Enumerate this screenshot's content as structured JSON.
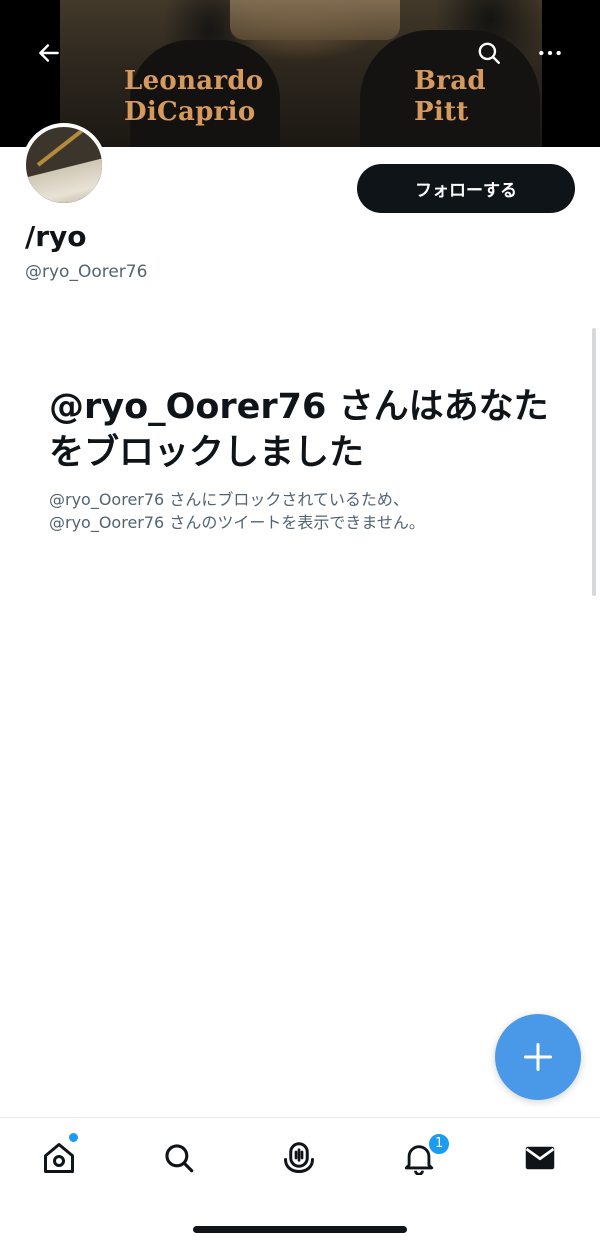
{
  "header": {
    "banner_text_left": [
      "Leonardo",
      "DiCaprio"
    ],
    "banner_text_right": [
      "Brad",
      "Pitt"
    ],
    "back_icon": "arrow-left-icon",
    "search_icon": "search-icon",
    "more_icon": "more-horizontal-icon"
  },
  "profile": {
    "display_name": "/ryo",
    "handle": "@ryo_Oorer76",
    "follow_label": "フォローする"
  },
  "blocked": {
    "title": "@ryo_Oorer76 さんはあなたをブロックしました",
    "description_line1": "@ryo_Oorer76 さんにブロックされているため、",
    "description_line2": "@ryo_Oorer76 さんのツイートを表示できません。"
  },
  "fab": {
    "icon": "plus-icon"
  },
  "tabbar": {
    "items": [
      {
        "name": "home",
        "icon": "home-icon",
        "has_dot": true
      },
      {
        "name": "search",
        "icon": "search-icon"
      },
      {
        "name": "spaces",
        "icon": "spaces-icon"
      },
      {
        "name": "notifications",
        "icon": "bell-icon",
        "badge": "1"
      },
      {
        "name": "messages",
        "icon": "mail-icon"
      }
    ]
  },
  "colors": {
    "accent": "#1d9bf0",
    "fab": "#4a99e9",
    "text_primary": "#0f1419",
    "text_secondary": "#536471",
    "banner_text": "#d79a5e"
  }
}
